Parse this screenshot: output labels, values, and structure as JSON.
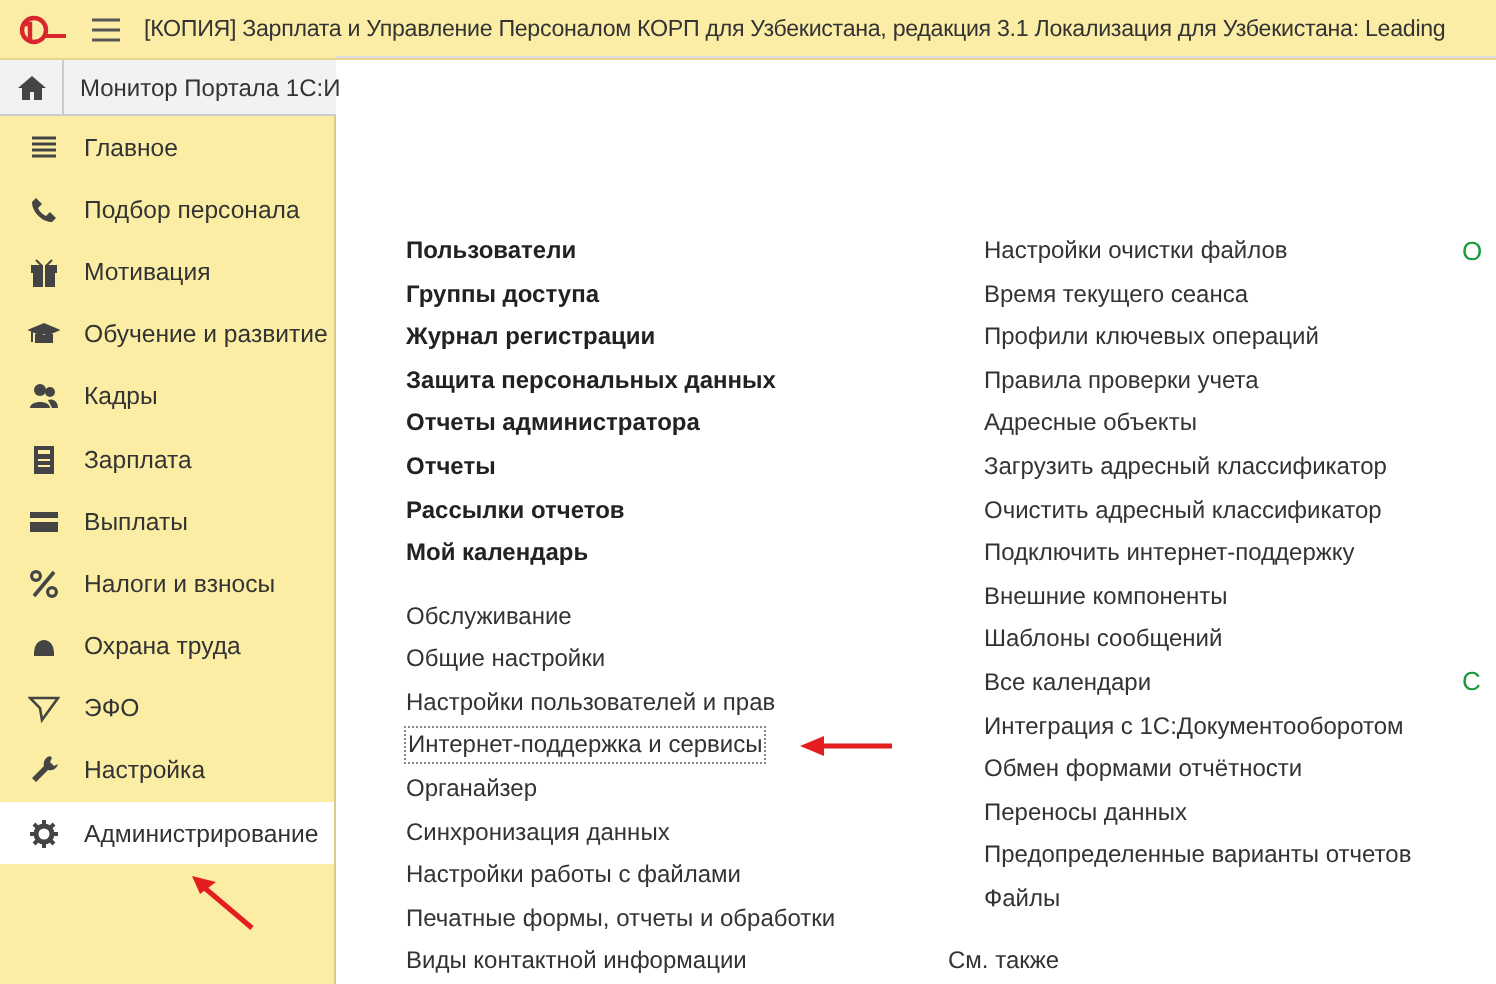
{
  "window": {
    "title": "[КОПИЯ] Зарплата и Управление Персоналом  КОРП для Узбекистана,  редакция 3.1 Локализация для Узбекистана: Leading"
  },
  "tabs": [
    {
      "label": "Монитор Портала 1С:И",
      "selected": false
    }
  ],
  "sidebar": {
    "items": [
      {
        "label": "Главное",
        "selected": false
      },
      {
        "label": "Подбор персонала",
        "selected": false
      },
      {
        "label": "Мотивация",
        "selected": false
      },
      {
        "label": "Обучение и развитие",
        "selected": false
      },
      {
        "label": "Кадры",
        "selected": false
      },
      {
        "label": "Зарплата",
        "selected": false
      },
      {
        "label": "Выплаты",
        "selected": false
      },
      {
        "label": "Налоги и взносы",
        "selected": false
      },
      {
        "label": "Охрана труда",
        "selected": false
      },
      {
        "label": "ЭФО",
        "selected": false
      },
      {
        "label": "Настройка",
        "selected": false
      },
      {
        "label": "Администрирование",
        "selected": true
      }
    ]
  },
  "column_1": {
    "bold_links": [
      "Пользователи",
      "Группы доступа",
      "Журнал регистрации",
      "Защита персональных данных",
      "Отчеты администратора",
      "Отчеты",
      "Рассылки отчетов",
      "Мой календарь"
    ],
    "links": [
      {
        "label": "Обслуживание",
        "focused": false
      },
      {
        "label": "Общие настройки",
        "focused": false
      },
      {
        "label": "Настройки пользователей и прав",
        "focused": false
      },
      {
        "label": "Интернет-поддержка и сервисы",
        "focused": true
      },
      {
        "label": "Органайзер",
        "focused": false
      },
      {
        "label": "Синхронизация данных",
        "focused": false
      },
      {
        "label": "Настройки работы с файлами",
        "focused": false
      },
      {
        "label": "Печатные формы, отчеты и обработки",
        "focused": false
      },
      {
        "label": "Виды контактной информации",
        "focused": false
      }
    ]
  },
  "column_2": {
    "links": [
      "Настройки очистки файлов",
      "Время текущего сеанса",
      "Профили ключевых операций",
      "Правила проверки учета",
      "Адресные объекты",
      "Загрузить адресный классификатор",
      "Очистить адресный классификатор",
      "Подключить интернет-поддержку",
      "Внешние компоненты",
      "Шаблоны сообщений",
      "Все календари",
      "Интеграция с 1С:Документооборотом",
      "Обмен формами отчётности",
      "Переносы данных",
      "Предопределенные варианты отчетов",
      "Файлы"
    ],
    "see_also": "См. также"
  },
  "column_3": {
    "headings": [
      "О",
      "С"
    ]
  }
}
